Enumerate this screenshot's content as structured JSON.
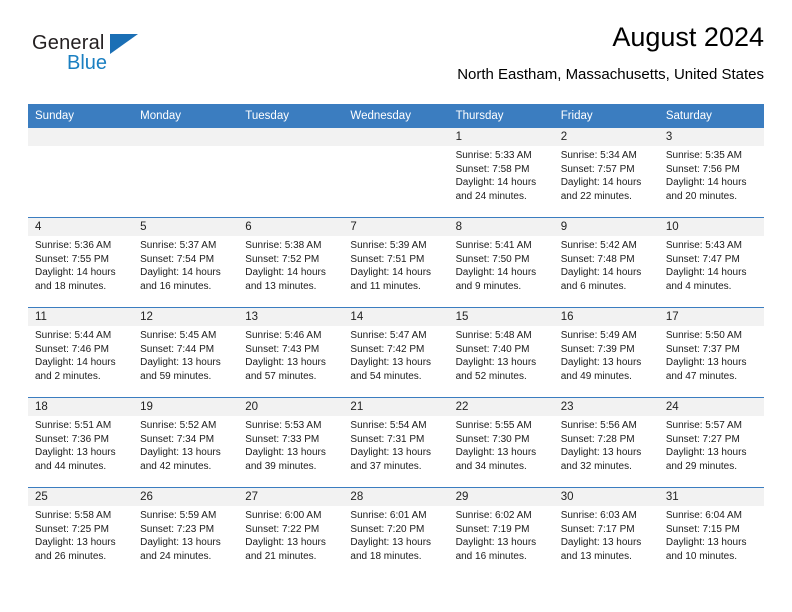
{
  "brand": {
    "name_part1": "General",
    "name_part2": "Blue",
    "triangle_icon": "triangle-icon",
    "accent_color": "#1b6fb5"
  },
  "header": {
    "title": "August 2024",
    "subtitle": "North Eastham, Massachusetts, United States"
  },
  "calendar": {
    "header_bg": "#3b7dc0",
    "daynum_bg": "#f2f2f2",
    "weekdays": [
      "Sunday",
      "Monday",
      "Tuesday",
      "Wednesday",
      "Thursday",
      "Friday",
      "Saturday"
    ],
    "weeks": [
      [
        {
          "day": "",
          "empty": true
        },
        {
          "day": "",
          "empty": true
        },
        {
          "day": "",
          "empty": true
        },
        {
          "day": "",
          "empty": true
        },
        {
          "day": "1",
          "sunrise": "Sunrise: 5:33 AM",
          "sunset": "Sunset: 7:58 PM",
          "daylight_1": "Daylight: 14 hours",
          "daylight_2": "and 24 minutes."
        },
        {
          "day": "2",
          "sunrise": "Sunrise: 5:34 AM",
          "sunset": "Sunset: 7:57 PM",
          "daylight_1": "Daylight: 14 hours",
          "daylight_2": "and 22 minutes."
        },
        {
          "day": "3",
          "sunrise": "Sunrise: 5:35 AM",
          "sunset": "Sunset: 7:56 PM",
          "daylight_1": "Daylight: 14 hours",
          "daylight_2": "and 20 minutes."
        }
      ],
      [
        {
          "day": "4",
          "sunrise": "Sunrise: 5:36 AM",
          "sunset": "Sunset: 7:55 PM",
          "daylight_1": "Daylight: 14 hours",
          "daylight_2": "and 18 minutes."
        },
        {
          "day": "5",
          "sunrise": "Sunrise: 5:37 AM",
          "sunset": "Sunset: 7:54 PM",
          "daylight_1": "Daylight: 14 hours",
          "daylight_2": "and 16 minutes."
        },
        {
          "day": "6",
          "sunrise": "Sunrise: 5:38 AM",
          "sunset": "Sunset: 7:52 PM",
          "daylight_1": "Daylight: 14 hours",
          "daylight_2": "and 13 minutes."
        },
        {
          "day": "7",
          "sunrise": "Sunrise: 5:39 AM",
          "sunset": "Sunset: 7:51 PM",
          "daylight_1": "Daylight: 14 hours",
          "daylight_2": "and 11 minutes."
        },
        {
          "day": "8",
          "sunrise": "Sunrise: 5:41 AM",
          "sunset": "Sunset: 7:50 PM",
          "daylight_1": "Daylight: 14 hours",
          "daylight_2": "and 9 minutes."
        },
        {
          "day": "9",
          "sunrise": "Sunrise: 5:42 AM",
          "sunset": "Sunset: 7:48 PM",
          "daylight_1": "Daylight: 14 hours",
          "daylight_2": "and 6 minutes."
        },
        {
          "day": "10",
          "sunrise": "Sunrise: 5:43 AM",
          "sunset": "Sunset: 7:47 PM",
          "daylight_1": "Daylight: 14 hours",
          "daylight_2": "and 4 minutes."
        }
      ],
      [
        {
          "day": "11",
          "sunrise": "Sunrise: 5:44 AM",
          "sunset": "Sunset: 7:46 PM",
          "daylight_1": "Daylight: 14 hours",
          "daylight_2": "and 2 minutes."
        },
        {
          "day": "12",
          "sunrise": "Sunrise: 5:45 AM",
          "sunset": "Sunset: 7:44 PM",
          "daylight_1": "Daylight: 13 hours",
          "daylight_2": "and 59 minutes."
        },
        {
          "day": "13",
          "sunrise": "Sunrise: 5:46 AM",
          "sunset": "Sunset: 7:43 PM",
          "daylight_1": "Daylight: 13 hours",
          "daylight_2": "and 57 minutes."
        },
        {
          "day": "14",
          "sunrise": "Sunrise: 5:47 AM",
          "sunset": "Sunset: 7:42 PM",
          "daylight_1": "Daylight: 13 hours",
          "daylight_2": "and 54 minutes."
        },
        {
          "day": "15",
          "sunrise": "Sunrise: 5:48 AM",
          "sunset": "Sunset: 7:40 PM",
          "daylight_1": "Daylight: 13 hours",
          "daylight_2": "and 52 minutes."
        },
        {
          "day": "16",
          "sunrise": "Sunrise: 5:49 AM",
          "sunset": "Sunset: 7:39 PM",
          "daylight_1": "Daylight: 13 hours",
          "daylight_2": "and 49 minutes."
        },
        {
          "day": "17",
          "sunrise": "Sunrise: 5:50 AM",
          "sunset": "Sunset: 7:37 PM",
          "daylight_1": "Daylight: 13 hours",
          "daylight_2": "and 47 minutes."
        }
      ],
      [
        {
          "day": "18",
          "sunrise": "Sunrise: 5:51 AM",
          "sunset": "Sunset: 7:36 PM",
          "daylight_1": "Daylight: 13 hours",
          "daylight_2": "and 44 minutes."
        },
        {
          "day": "19",
          "sunrise": "Sunrise: 5:52 AM",
          "sunset": "Sunset: 7:34 PM",
          "daylight_1": "Daylight: 13 hours",
          "daylight_2": "and 42 minutes."
        },
        {
          "day": "20",
          "sunrise": "Sunrise: 5:53 AM",
          "sunset": "Sunset: 7:33 PM",
          "daylight_1": "Daylight: 13 hours",
          "daylight_2": "and 39 minutes."
        },
        {
          "day": "21",
          "sunrise": "Sunrise: 5:54 AM",
          "sunset": "Sunset: 7:31 PM",
          "daylight_1": "Daylight: 13 hours",
          "daylight_2": "and 37 minutes."
        },
        {
          "day": "22",
          "sunrise": "Sunrise: 5:55 AM",
          "sunset": "Sunset: 7:30 PM",
          "daylight_1": "Daylight: 13 hours",
          "daylight_2": "and 34 minutes."
        },
        {
          "day": "23",
          "sunrise": "Sunrise: 5:56 AM",
          "sunset": "Sunset: 7:28 PM",
          "daylight_1": "Daylight: 13 hours",
          "daylight_2": "and 32 minutes."
        },
        {
          "day": "24",
          "sunrise": "Sunrise: 5:57 AM",
          "sunset": "Sunset: 7:27 PM",
          "daylight_1": "Daylight: 13 hours",
          "daylight_2": "and 29 minutes."
        }
      ],
      [
        {
          "day": "25",
          "sunrise": "Sunrise: 5:58 AM",
          "sunset": "Sunset: 7:25 PM",
          "daylight_1": "Daylight: 13 hours",
          "daylight_2": "and 26 minutes."
        },
        {
          "day": "26",
          "sunrise": "Sunrise: 5:59 AM",
          "sunset": "Sunset: 7:23 PM",
          "daylight_1": "Daylight: 13 hours",
          "daylight_2": "and 24 minutes."
        },
        {
          "day": "27",
          "sunrise": "Sunrise: 6:00 AM",
          "sunset": "Sunset: 7:22 PM",
          "daylight_1": "Daylight: 13 hours",
          "daylight_2": "and 21 minutes."
        },
        {
          "day": "28",
          "sunrise": "Sunrise: 6:01 AM",
          "sunset": "Sunset: 7:20 PM",
          "daylight_1": "Daylight: 13 hours",
          "daylight_2": "and 18 minutes."
        },
        {
          "day": "29",
          "sunrise": "Sunrise: 6:02 AM",
          "sunset": "Sunset: 7:19 PM",
          "daylight_1": "Daylight: 13 hours",
          "daylight_2": "and 16 minutes."
        },
        {
          "day": "30",
          "sunrise": "Sunrise: 6:03 AM",
          "sunset": "Sunset: 7:17 PM",
          "daylight_1": "Daylight: 13 hours",
          "daylight_2": "and 13 minutes."
        },
        {
          "day": "31",
          "sunrise": "Sunrise: 6:04 AM",
          "sunset": "Sunset: 7:15 PM",
          "daylight_1": "Daylight: 13 hours",
          "daylight_2": "and 10 minutes."
        }
      ]
    ]
  }
}
